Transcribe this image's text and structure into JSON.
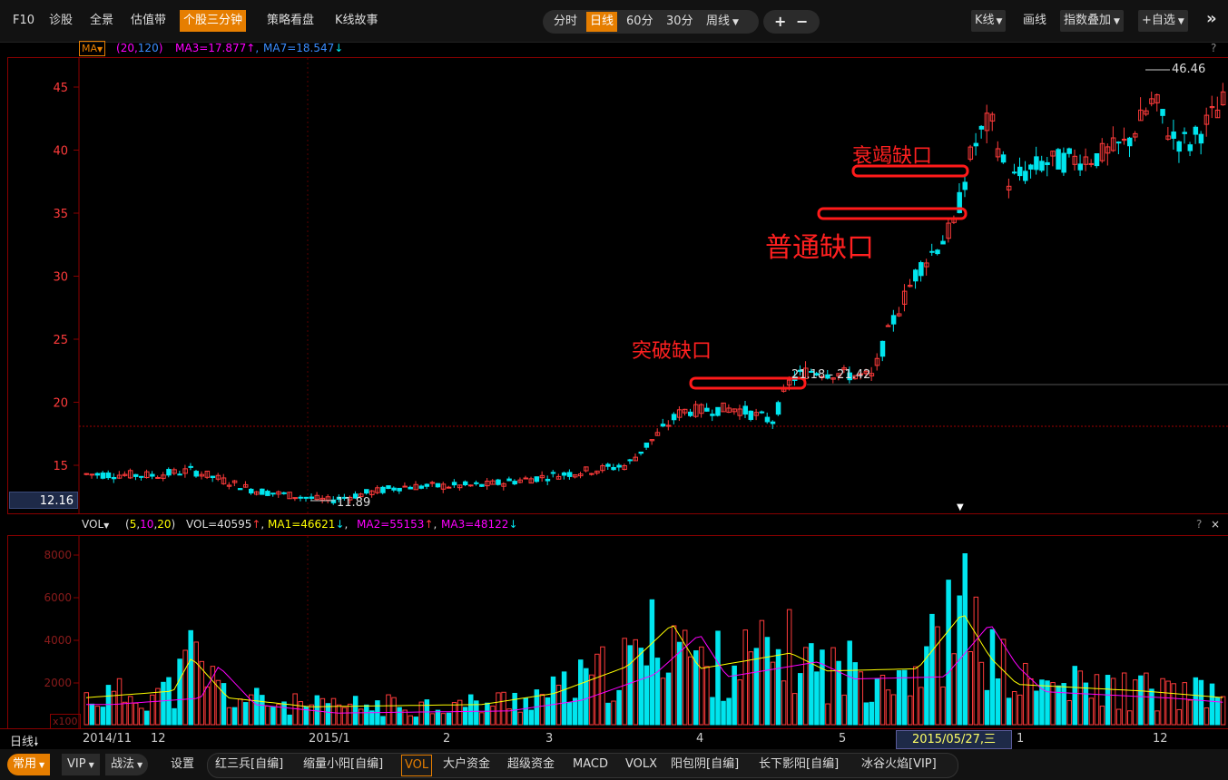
{
  "toolbar": {
    "left_items": [
      "F10",
      "诊股",
      "全景",
      "估值带",
      "个股三分钟",
      "策略看盘",
      "K线故事"
    ],
    "active_left": "个股三分钟",
    "periods": [
      "分时",
      "日线",
      "60分",
      "30分",
      "周线"
    ],
    "active_period": "日线",
    "zoom_in": "+",
    "zoom_out": "−",
    "kline_label": "K线",
    "draw_label": "画线",
    "index_overlay_label": "指数叠加",
    "watchlist_label": "+自选",
    "collapse_icon": "»"
  },
  "ma_bar": {
    "selector": "MA",
    "params_open": "(",
    "param1": "20",
    "comma": ",",
    "param2": "120",
    "params_close": ")",
    "ma3": "MA3=17.877",
    "ma7": "MA7=18.547",
    "help": "?"
  },
  "price_axis": {
    "labels": [
      "45",
      "40",
      "35",
      "30",
      "25",
      "20",
      "15"
    ],
    "current_price": "12.16"
  },
  "annotations": {
    "breakaway_gap": "突破缺口",
    "common_gap": "普通缺口",
    "exhaustion_gap": "衰竭缺口",
    "high_label": "46.46",
    "low_label": "11.89",
    "gap_range_label": "21.18 - 21.42"
  },
  "vol_bar": {
    "selector": "VOL",
    "params_open": "(",
    "p1": "5",
    "c1": ",",
    "p2": "10",
    "c2": ",",
    "p3": "20",
    "params_close": ")",
    "vol": "VOL=40595",
    "ma1": "MA1=46621",
    "ma2": "MA2=55153",
    "ma3": "MA3=48122",
    "help": "?",
    "close": "×"
  },
  "vol_axis": {
    "labels": [
      "8000",
      "6000",
      "4000",
      "2000"
    ],
    "unit": "x100"
  },
  "date_axis": {
    "period_selector": "日线",
    "labels": [
      "2014/11",
      "12",
      "2015/1",
      "2",
      "3",
      "4",
      "5",
      "1",
      "12"
    ],
    "cursor_date": "2015/05/27,三"
  },
  "bottom_tabs": {
    "common": "常用",
    "vip": "VIP",
    "strategy": "战法",
    "settings": "设置",
    "indicators": [
      "红三兵[自编]",
      "缩量小阳[自编]",
      "VOL",
      "大户资金",
      "超级资金",
      "MACD",
      "VOLX",
      "阳包阴[自编]",
      "长下影阳[自编]",
      "冰谷火焰[VIP]"
    ],
    "active_indicator": "VOL"
  },
  "colors": {
    "up": "#ff3b3b",
    "down": "#00e5ee",
    "accent": "#e67e00",
    "ma_white": "#ffffff",
    "ma_yellow": "#ffff00",
    "ma_pink": "#ff00ff",
    "border": "#8a0000"
  }
}
